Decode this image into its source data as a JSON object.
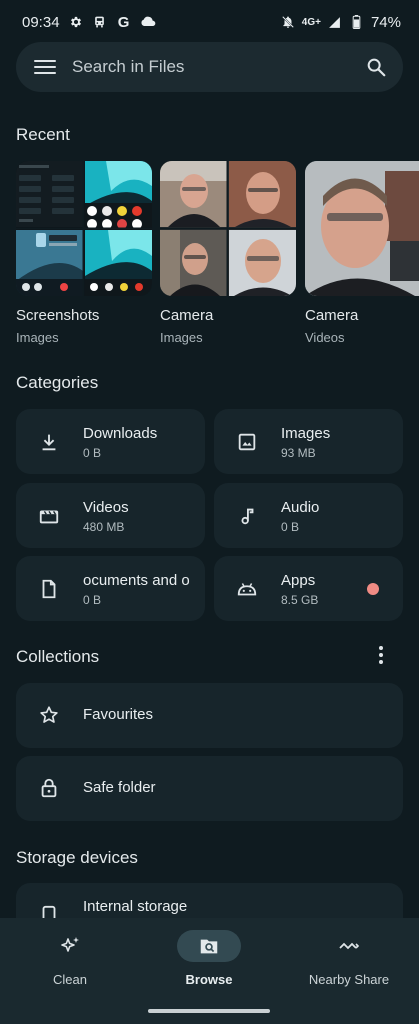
{
  "status_bar": {
    "time": "09:34",
    "network": "4G+",
    "battery": "74%",
    "icons": [
      "settings-icon",
      "train-icon",
      "google-icon",
      "cloud-icon",
      "mute-icon",
      "signal-icon",
      "battery-icon"
    ]
  },
  "search": {
    "placeholder": "Search in Files"
  },
  "recent": {
    "title": "Recent",
    "items": [
      {
        "name": "Screenshots",
        "type": "Images"
      },
      {
        "name": "Camera",
        "type": "Images"
      },
      {
        "name": "Camera",
        "type": "Videos"
      }
    ]
  },
  "categories": {
    "title": "Categories",
    "items": [
      {
        "name": "Downloads",
        "size": "0 B",
        "icon": "download-icon"
      },
      {
        "name": "Images",
        "size": "93 MB",
        "icon": "image-icon"
      },
      {
        "name": "Videos",
        "size": "480 MB",
        "icon": "clapperboard-icon"
      },
      {
        "name": "Audio",
        "size": "0 B",
        "icon": "music-note-icon"
      },
      {
        "name": "ocuments and o",
        "size": "0 B",
        "icon": "document-icon"
      },
      {
        "name": "Apps",
        "size": "8.5 GB",
        "icon": "android-icon"
      }
    ]
  },
  "collections": {
    "title": "Collections",
    "items": [
      {
        "name": "Favourites",
        "icon": "star-icon"
      },
      {
        "name": "Safe folder",
        "icon": "lock-icon"
      }
    ]
  },
  "storage": {
    "title": "Storage devices",
    "items": [
      {
        "name": "Internal storage",
        "icon": "phone-icon"
      }
    ]
  },
  "bottom_nav": {
    "items": [
      {
        "label": "Clean",
        "icon": "sparkle-icon",
        "active": false
      },
      {
        "label": "Browse",
        "icon": "browse-icon",
        "active": true
      },
      {
        "label": "Nearby Share",
        "icon": "nearby-share-icon",
        "active": false
      }
    ]
  },
  "colors": {
    "background": "#0f1b20",
    "card": "#17252b",
    "apps_dot": "#f08b84",
    "active_pill": "#334a52"
  }
}
